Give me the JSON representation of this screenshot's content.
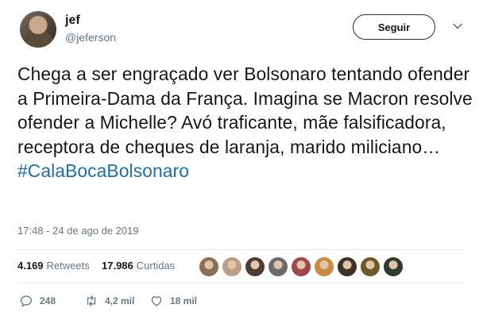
{
  "user": {
    "name": "jef",
    "handle": "@jeferson"
  },
  "follow_button": {
    "label": "Seguir"
  },
  "tweet": {
    "text": "Chega a ser engraçado ver Bolsonaro tentando ofender a Primeira-Dama da França. Imagina se Macron resolve ofender a Michelle? Avó traficante, mãe falsificadora, receptora de cheques de laranja, marido miliciano… ",
    "hashtag": "#CalaBocaBolsonaro",
    "timestamp": "17:48 - 24 de ago de 2019"
  },
  "stats": {
    "retweets_count": "4.169",
    "retweets_label": "Retweets",
    "likes_count": "17.986",
    "likes_label": "Curtidas"
  },
  "likers": [
    {
      "color": "#8a6f55"
    },
    {
      "color": "#b9a08a"
    },
    {
      "color": "#4e3b35"
    },
    {
      "color": "#6b6b6b"
    },
    {
      "color": "#a3474a"
    },
    {
      "color": "#c98b3e"
    },
    {
      "color": "#3c3228"
    },
    {
      "color": "#6a5a2c"
    },
    {
      "color": "#2e3a2a"
    }
  ],
  "actions": {
    "replies": "248",
    "retweets": "4,2 mil",
    "likes": "18 mil"
  },
  "icons": {
    "chevron": "chevron-down-icon",
    "reply": "reply-icon",
    "retweet": "retweet-icon",
    "like": "heart-icon"
  }
}
